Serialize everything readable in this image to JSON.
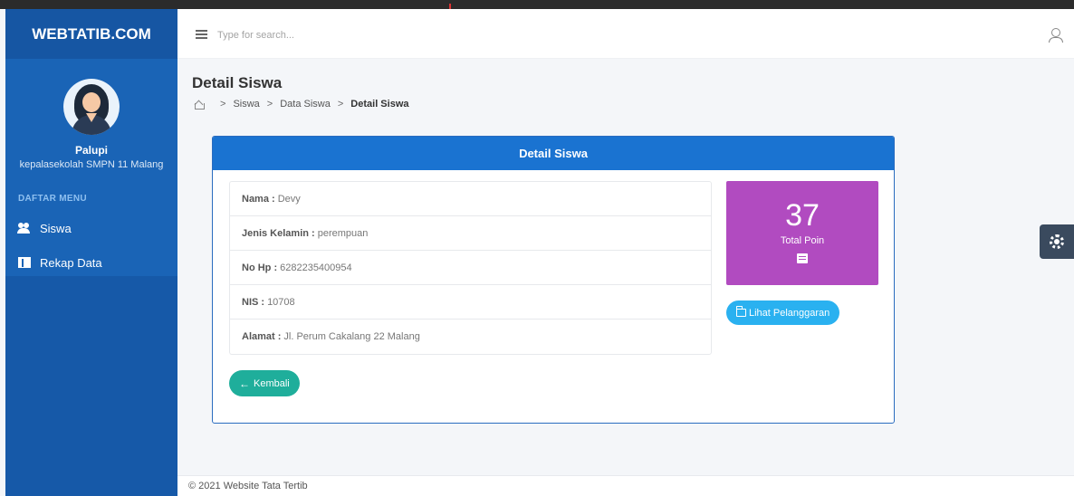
{
  "brand": {
    "name": "WEBTATIB.COM"
  },
  "profile": {
    "name": "Palupi",
    "role": "kepalasekolah SMPN 11 Malang"
  },
  "sidebar": {
    "menu_header": "DAFTAR MENU",
    "items": [
      {
        "label": "Siswa",
        "icon": "users-icon"
      },
      {
        "label": "Rekap Data",
        "icon": "book-icon"
      }
    ]
  },
  "topnav": {
    "search_placeholder": "Type for search..."
  },
  "page": {
    "title": "Detail Siswa",
    "breadcrumb": [
      "Siswa",
      "Data Siswa",
      "Detail Siswa"
    ]
  },
  "card": {
    "title": "Detail Siswa",
    "fields": [
      {
        "label": "Nama :",
        "value": "Devy"
      },
      {
        "label": "Jenis Kelamin :",
        "value": "perempuan"
      },
      {
        "label": "No Hp :",
        "value": "6282235400954"
      },
      {
        "label": "NIS :",
        "value": "10708"
      },
      {
        "label": "Alamat :",
        "value": "Jl. Perum Cakalang 22 Malang"
      }
    ],
    "poin": {
      "value": "37",
      "label": "Total Poin"
    },
    "pelanggaran_button": "Lihat Pelanggaran",
    "back_button": "Kembali"
  },
  "footer": {
    "text": "© 2021 Website Tata Tertib"
  },
  "colors": {
    "sidebar": "#1760b0",
    "card_header": "#1a73d1",
    "poin_box": "#b14bc0",
    "pelanggaran_button": "#2ab1f0",
    "back_button": "#1fae9b"
  }
}
